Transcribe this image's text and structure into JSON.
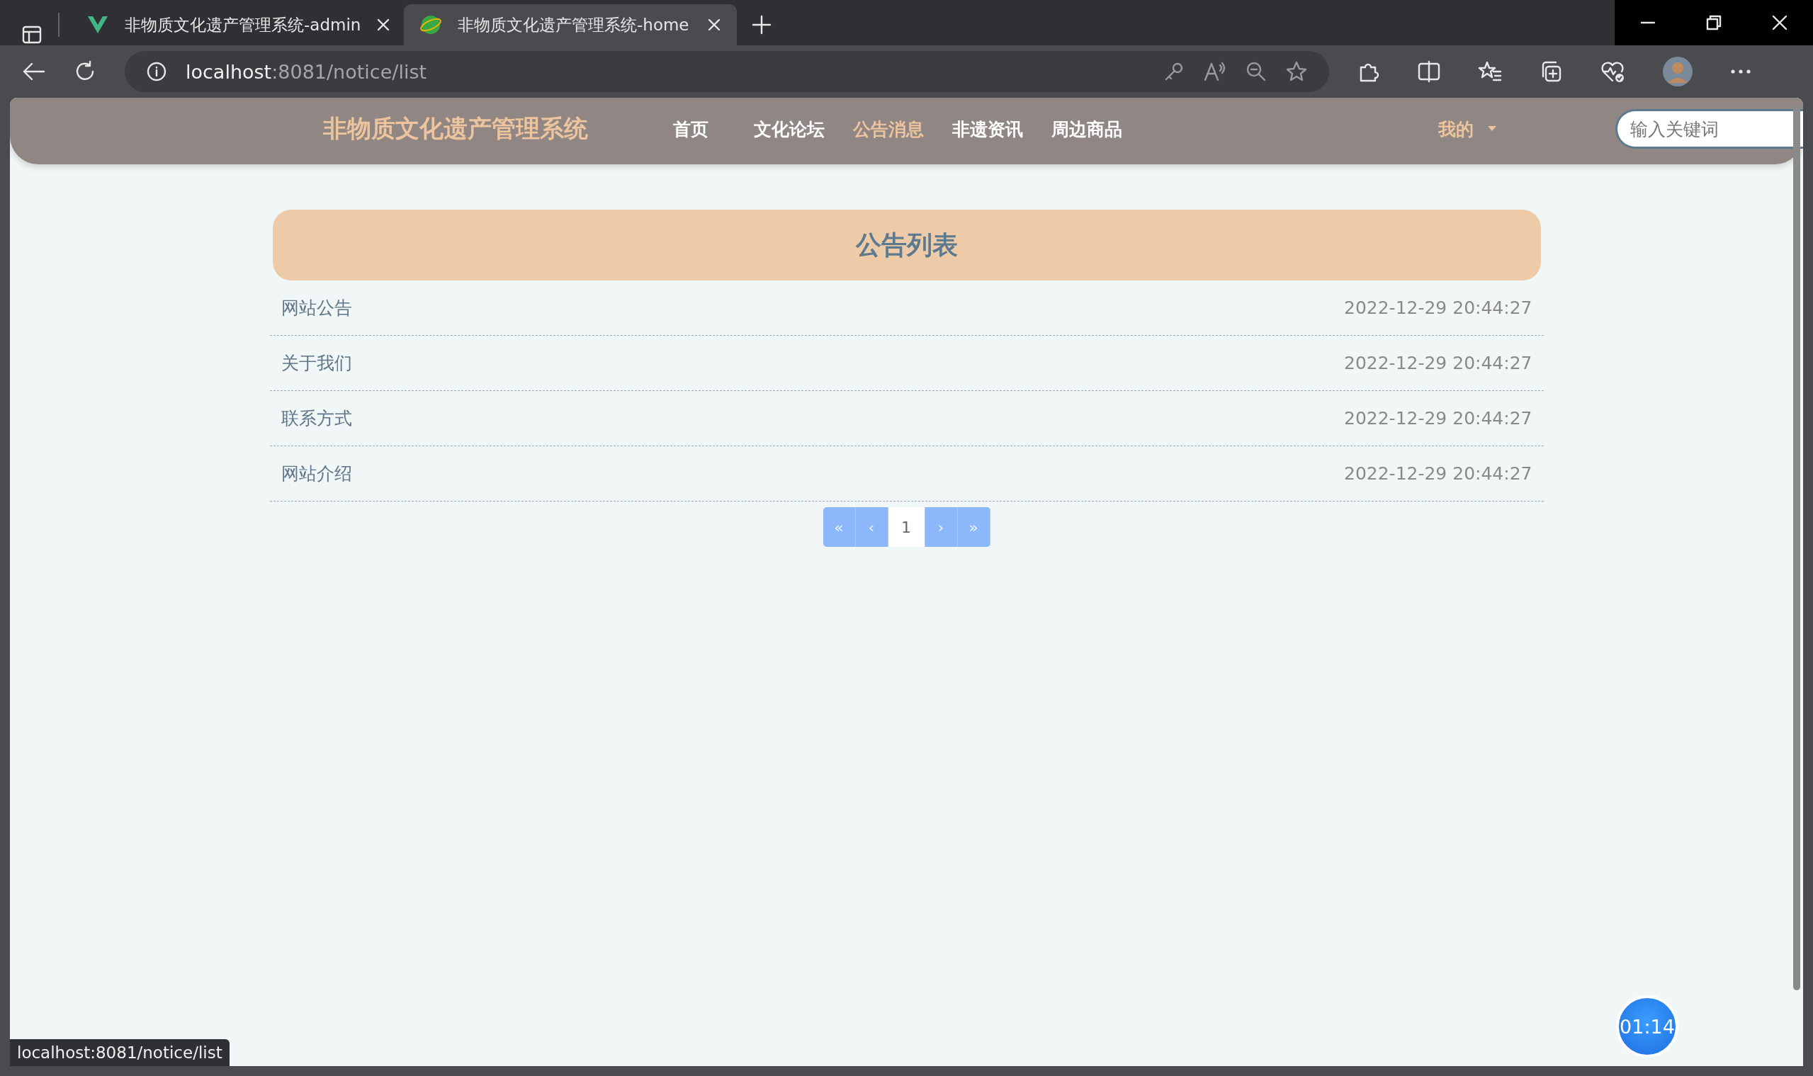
{
  "browser": {
    "tabs": [
      {
        "title": "非物质文化遗产管理系统-admin",
        "selected": false
      },
      {
        "title": "非物质文化遗产管理系统-home",
        "selected": true
      }
    ],
    "address": {
      "host": "localhost",
      "path": ":8081/notice/list"
    }
  },
  "nav": {
    "brand": "非物质文化遗产管理系统",
    "items": [
      {
        "label": "首页",
        "selected": false
      },
      {
        "label": "文化论坛",
        "selected": false
      },
      {
        "label": "公告消息",
        "selected": true
      },
      {
        "label": "非遗资讯",
        "selected": false
      },
      {
        "label": "周边商品",
        "selected": false
      }
    ],
    "user_menu": "我的",
    "search": {
      "placeholder": "输入关键词"
    }
  },
  "notice_list": {
    "title": "公告列表",
    "rows": [
      {
        "title": "网站公告",
        "time": "2022-12-29 20:44:27"
      },
      {
        "title": "关于我们",
        "time": "2022-12-29 20:44:27"
      },
      {
        "title": "联系方式",
        "time": "2022-12-29 20:44:27"
      },
      {
        "title": "网站介绍",
        "time": "2022-12-29 20:44:27"
      }
    ]
  },
  "pagination": {
    "first": "«",
    "prev": "‹",
    "pages": [
      {
        "label": "1",
        "selected": true
      }
    ],
    "next": "›",
    "last": "»"
  },
  "status_bar": {
    "link_preview": "localhost:8081/notice/list"
  },
  "recording_timer": "01:14"
}
